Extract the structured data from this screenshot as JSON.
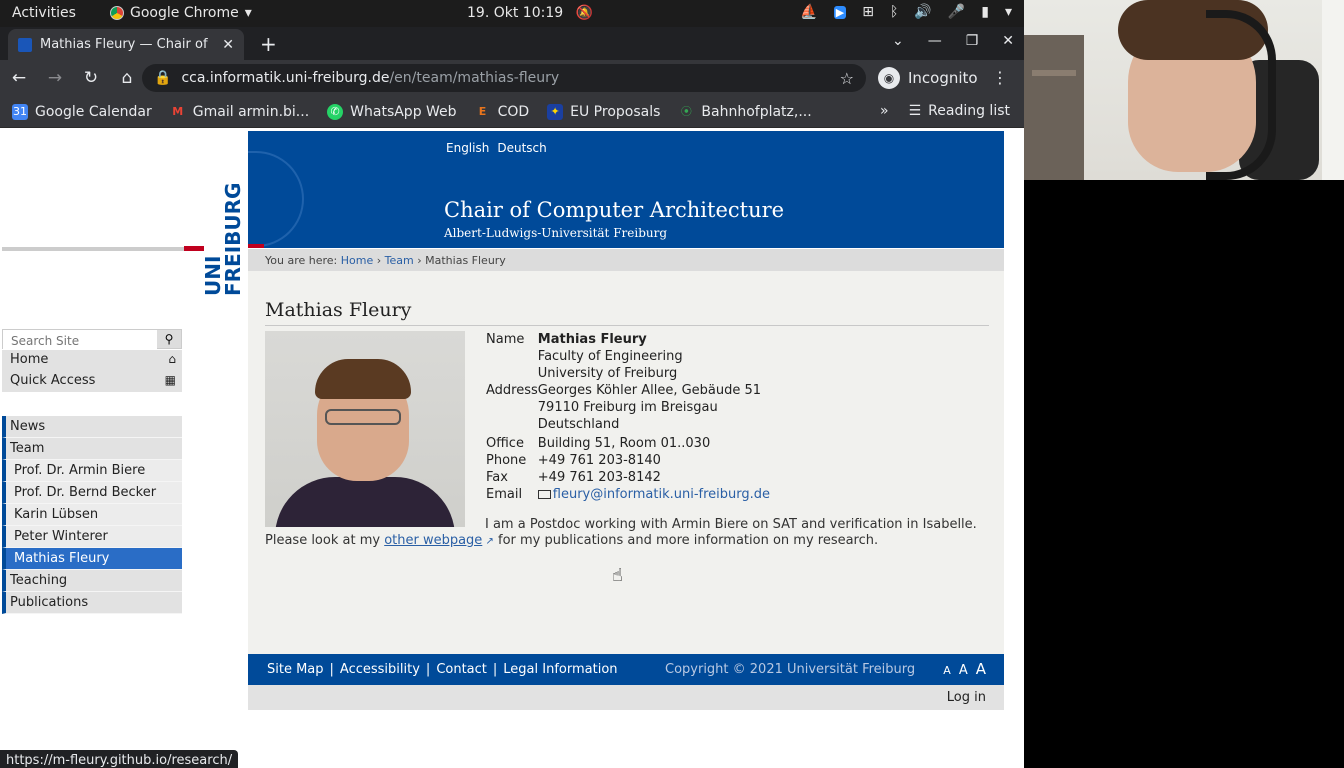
{
  "system": {
    "activities": "Activities",
    "app_name": "Google Chrome",
    "clock": "19. Okt  10:19"
  },
  "browser": {
    "tab_title": "Mathias Fleury — Chair of",
    "url_host": "cca.informatik.uni-freiburg.de",
    "url_path": "/en/team/mathias-fleury",
    "profile": "Incognito",
    "bookmarks": [
      {
        "label": "Google Calendar",
        "color": "#4285f4",
        "glyph": "31"
      },
      {
        "label": "Gmail armin.bi...",
        "color": "#ea4335",
        "glyph": "M"
      },
      {
        "label": "WhatsApp Web",
        "color": "#25d366",
        "glyph": "✆"
      },
      {
        "label": "COD",
        "color": "#e8741c",
        "glyph": "E"
      },
      {
        "label": "EU Proposals",
        "color": "#1a3fa0",
        "glyph": "✦"
      },
      {
        "label": "Bahnhofplatz,...",
        "color": "#34a853",
        "glyph": "⦿"
      }
    ],
    "reading_list": "Reading list",
    "status_url": "https://m-fleury.github.io/research/"
  },
  "site": {
    "lang_en": "English",
    "lang_de": "Deutsch",
    "chair_title": "Chair of Computer Architecture",
    "university": "Albert-Ludwigs-Universität Freiburg",
    "logo_text": "UNI FREIBURG",
    "breadcrumb_prefix": "You are here:",
    "breadcrumb_home": "Home",
    "breadcrumb_team": "Team",
    "breadcrumb_current": "Mathias Fleury",
    "search_placeholder": "Search Site",
    "home_link": "Home",
    "quick_access": "Quick Access",
    "menu": [
      {
        "label": "News",
        "level": 0
      },
      {
        "label": "Team",
        "level": 0
      },
      {
        "label": "Prof. Dr. Armin Biere",
        "level": 1
      },
      {
        "label": "Prof. Dr. Bernd Becker",
        "level": 1
      },
      {
        "label": "Karin Lübsen",
        "level": 1
      },
      {
        "label": "Peter Winterer",
        "level": 1
      },
      {
        "label": "Mathias Fleury",
        "level": 1,
        "active": true
      },
      {
        "label": "Teaching",
        "level": 0
      },
      {
        "label": "Publications",
        "level": 0
      }
    ]
  },
  "person": {
    "heading": "Mathias Fleury",
    "name_label": "Name",
    "name": "Mathias Fleury",
    "address_label": "Address",
    "address_lines": [
      "Faculty of Engineering",
      "University of Freiburg",
      "Georges Köhler Allee, Gebäude 51",
      "79110 Freiburg im Breisgau",
      "Deutschland"
    ],
    "office_label": "Office",
    "office": "Building 51, Room 01..030",
    "phone_label": "Phone",
    "phone": "+49 761 203-8140",
    "fax_label": "Fax",
    "fax": "+49 761 203-8142",
    "email_label": "Email",
    "email": "fleury@informatik.uni-freiburg.de",
    "bio_before": "I am a Postdoc working with Armin Biere on SAT and verification in Isabelle. Please look at my ",
    "bio_link": "other webpage",
    "bio_after": " for my publications and more information on my research."
  },
  "footer": {
    "links": [
      "Site Map",
      "Accessibility",
      "Contact",
      "Legal Information"
    ],
    "separator": "|",
    "copyright": "Copyright © 2021 Universität Freiburg",
    "font_sizes": [
      "A",
      "A",
      "A"
    ],
    "login": "Log in"
  },
  "colors": {
    "brand_blue": "#004a99",
    "accent_red": "#c0001e",
    "active_nav": "#2a6dc6"
  }
}
